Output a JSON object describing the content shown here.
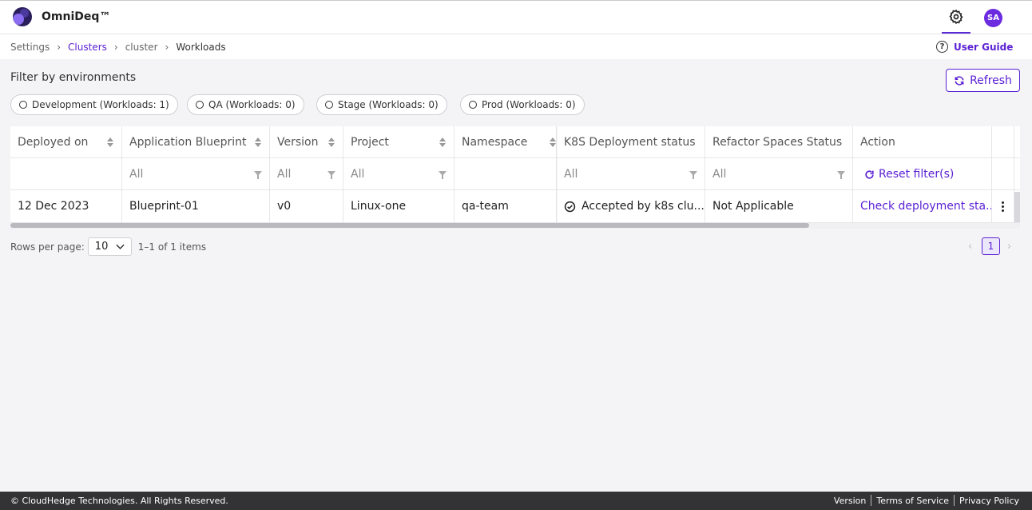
{
  "app": {
    "brand": "OmniDeq™"
  },
  "header": {
    "settings_icon": "gear-icon",
    "avatar_initials": "SA"
  },
  "breadcrumb": {
    "items": [
      {
        "label": "Settings",
        "link": false
      },
      {
        "label": "Clusters",
        "link": true
      },
      {
        "label": "cluster",
        "link": false
      },
      {
        "label": "Workloads",
        "link": false
      }
    ],
    "separator": "›"
  },
  "user_guide": {
    "label": "User Guide",
    "icon": "?"
  },
  "filters": {
    "title": "Filter by environments",
    "refresh_label": "Refresh",
    "environments": [
      "Development (Workloads: 1)",
      "QA (Workloads: 0)",
      "Stage (Workloads: 0)",
      "Prod (Workloads: 0)"
    ]
  },
  "table": {
    "columns": [
      "Deployed on",
      "Application Blueprint",
      "Version",
      "Project",
      "Namespace",
      "K8S Deployment status",
      "Refactor Spaces Status",
      "Action"
    ],
    "filter_row": {
      "blueprint": "All",
      "version": "All",
      "project": "All",
      "k8s_status": "All",
      "refactor_status": "All",
      "reset_label": "Reset filter(s)"
    },
    "rows": [
      {
        "deployed_on": "12 Dec 2023",
        "blueprint": "Blueprint-01",
        "version": "v0",
        "project": "Linux-one",
        "namespace": "qa-team",
        "k8s_status": "Accepted by k8s clu...",
        "refactor_status": "Not Applicable",
        "action": "Check deployment sta..."
      }
    ]
  },
  "pagination": {
    "rows_per_page_label": "Rows per page:",
    "rows_per_page": "10",
    "range": "1–1 of 1 items",
    "current_page": "1",
    "prev": "‹",
    "next": "›"
  },
  "footer": {
    "copyright": "© CloudHedge Technologies. All Rights Reserved.",
    "links": [
      "Version",
      "Terms of Service",
      "Privacy Policy"
    ]
  },
  "colors": {
    "accent": "#5b21d4",
    "footer_bg": "#333336"
  }
}
